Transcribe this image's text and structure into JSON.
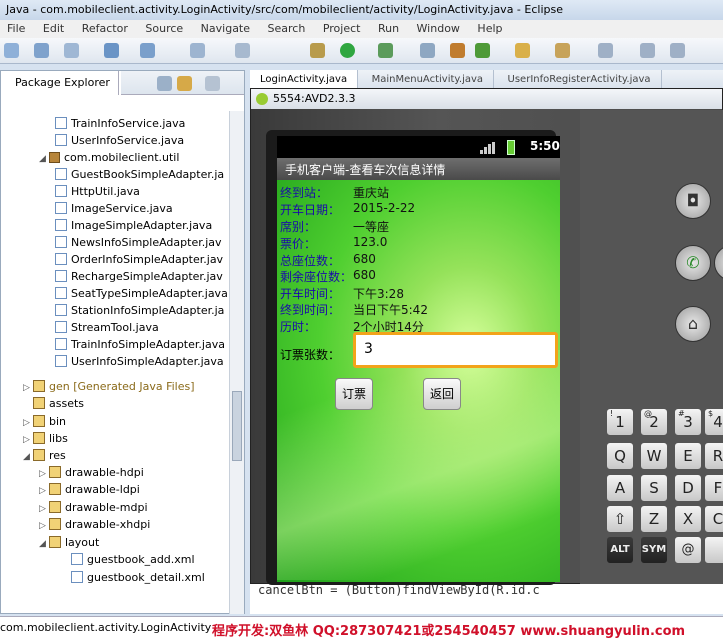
{
  "window": {
    "title": "Java - com.mobileclient.activity.LoginActivity/src/com/mobileclient/activity/LoginActivity.java - Eclipse"
  },
  "menu": [
    "File",
    "Edit",
    "Refactor",
    "Source",
    "Navigate",
    "Search",
    "Project",
    "Run",
    "Window",
    "Help"
  ],
  "package_explorer": {
    "tab_label": "Package Explorer",
    "close_glyph": "✕",
    "items": [
      {
        "label": "TrainInfoService.java",
        "kind": "java"
      },
      {
        "label": "UserInfoService.java",
        "kind": "java"
      },
      {
        "label": "com.mobileclient.util",
        "kind": "package"
      },
      {
        "label": "GuestBookSimpleAdapter.ja",
        "kind": "java"
      },
      {
        "label": "HttpUtil.java",
        "kind": "java"
      },
      {
        "label": "ImageService.java",
        "kind": "java"
      },
      {
        "label": "ImageSimpleAdapter.java",
        "kind": "java"
      },
      {
        "label": "NewsInfoSimpleAdapter.jav",
        "kind": "java"
      },
      {
        "label": "OrderInfoSimpleAdapter.jav",
        "kind": "java"
      },
      {
        "label": "RechargeSimpleAdapter.jav",
        "kind": "java"
      },
      {
        "label": "SeatTypeSimpleAdapter.java",
        "kind": "java"
      },
      {
        "label": "StationInfoSimpleAdapter.ja",
        "kind": "java"
      },
      {
        "label": "StreamTool.java",
        "kind": "java"
      },
      {
        "label": "TrainInfoSimpleAdapter.java",
        "kind": "java"
      },
      {
        "label": "UserInfoSimpleAdapter.java",
        "kind": "java"
      },
      {
        "label": "gen [Generated Java Files]",
        "kind": "folder"
      },
      {
        "label": "assets",
        "kind": "folder"
      },
      {
        "label": "bin",
        "kind": "folder"
      },
      {
        "label": "libs",
        "kind": "folder"
      },
      {
        "label": "res",
        "kind": "folder"
      },
      {
        "label": "drawable-hdpi",
        "kind": "folder"
      },
      {
        "label": "drawable-ldpi",
        "kind": "folder"
      },
      {
        "label": "drawable-mdpi",
        "kind": "folder"
      },
      {
        "label": "drawable-xhdpi",
        "kind": "folder"
      },
      {
        "label": "layout",
        "kind": "folder"
      },
      {
        "label": "guestbook_add.xml",
        "kind": "xml"
      },
      {
        "label": "guestbook_detail.xml",
        "kind": "xml"
      }
    ]
  },
  "editor": {
    "tabs": [
      "LoginActivity.java",
      "MainMenuActivity.java",
      "UserInfoRegisterActivity.java"
    ],
    "visible_code": "cancelBtn = (Button)findViewById(R.id.c"
  },
  "emulator": {
    "title": "5554:AVD2.3.3",
    "clock": "5:50",
    "app_title": "手机客户端-查看车次信息详情",
    "fields": [
      {
        "label": "终到站：",
        "value": "重庆站"
      },
      {
        "label": "开车日期：",
        "value": "2015-2-22"
      },
      {
        "label": "席别：",
        "value": "一等座"
      },
      {
        "label": "票价：",
        "value": "123.0"
      },
      {
        "label": "总座位数：",
        "value": "680"
      },
      {
        "label": "剩余座位数：",
        "value": "680"
      },
      {
        "label": "开车时间：",
        "value": "下午3:28"
      },
      {
        "label": "终到时间：",
        "value": "当日下午5:42"
      },
      {
        "label": "历时：",
        "value": "2个小时14分"
      }
    ],
    "qty_label": "订票张数：",
    "qty_value": "3",
    "book_button": "订票",
    "back_button": "返回",
    "keys": {
      "row1": [
        {
          "main": "1",
          "alt": "!"
        },
        {
          "main": "2",
          "alt": "@"
        },
        {
          "main": "3",
          "alt": "#"
        },
        {
          "main": "4",
          "alt": "$"
        }
      ],
      "row2": [
        "Q",
        "W",
        "E",
        "R"
      ],
      "row3": [
        "A",
        "S",
        "D",
        "F"
      ],
      "row4": [
        "⇧",
        "Z",
        "X",
        "C"
      ],
      "row5": [
        "ALT",
        "SYM",
        "@",
        " "
      ]
    }
  },
  "status": {
    "text": "com.mobileclient.activity.LoginActivity",
    "credit": "程序开发:双鱼林 QQ:287307421或254540457 www.shuangyulin.com"
  }
}
